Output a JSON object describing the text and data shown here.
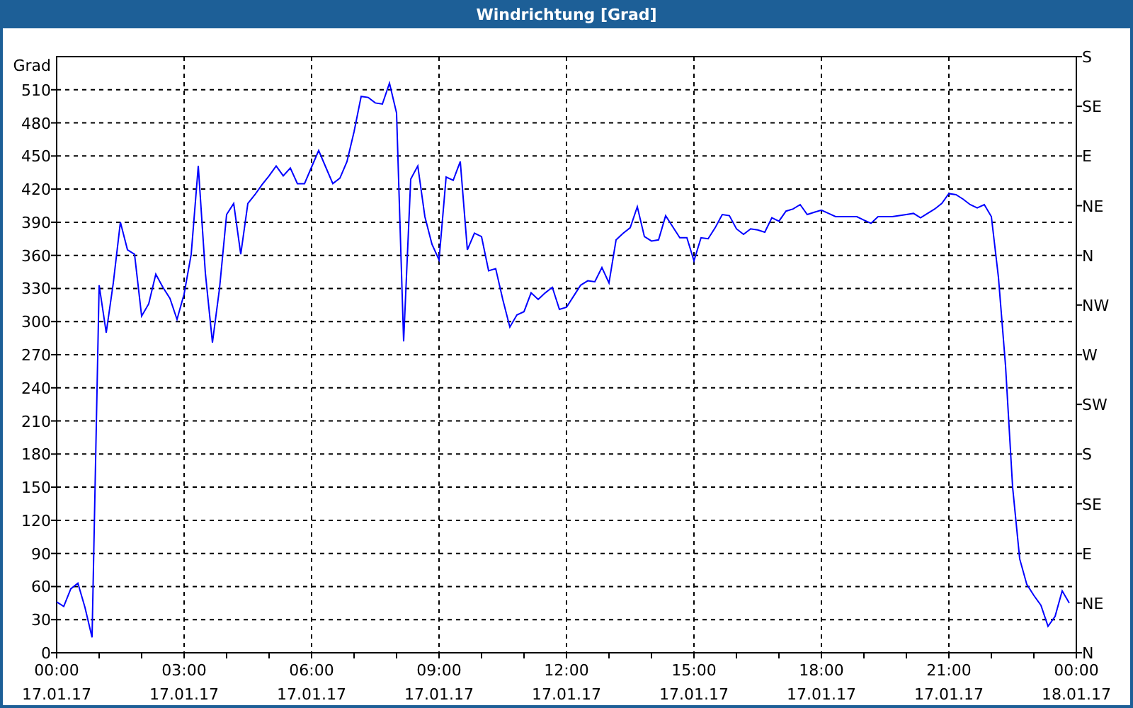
{
  "chart": {
    "chart_data": {
      "type": "line",
      "title": "Windrichtung [Grad]",
      "ylabel": "Grad",
      "ylim": [
        0,
        540
      ],
      "grid": true,
      "categories": [
        "00:00\n17.01.17",
        null,
        null,
        null,
        null,
        null,
        null,
        null,
        null,
        null,
        null,
        null,
        null,
        null,
        null,
        null,
        null,
        null,
        "03:00\n17.01.17",
        null,
        null,
        null,
        null,
        null,
        null,
        null,
        null,
        null,
        null,
        null,
        null,
        null,
        null,
        null,
        null,
        null,
        "06:00\n17.01.17",
        null,
        null,
        null,
        null,
        null,
        null,
        null,
        null,
        null,
        null,
        null,
        null,
        null,
        null,
        null,
        null,
        null,
        "09:00\n17.01.17",
        null,
        null,
        null,
        null,
        null,
        null,
        null,
        null,
        null,
        null,
        null,
        null,
        null,
        null,
        null,
        null,
        null,
        "12:00\n17.01.17",
        null,
        null,
        null,
        null,
        null,
        null,
        null,
        null,
        null,
        null,
        null,
        null,
        null,
        null,
        null,
        null,
        null,
        "15:00\n17.01.17",
        null,
        null,
        null,
        null,
        null,
        null,
        null,
        null,
        null,
        null,
        null,
        null,
        null,
        null,
        null,
        null,
        null,
        "18:00\n17.01.17",
        null,
        null,
        null,
        null,
        null,
        null,
        null,
        null,
        null,
        null,
        null,
        null,
        null,
        null,
        null,
        null,
        null,
        "21:00\n17.01.17",
        null,
        null,
        null,
        null,
        null,
        null,
        null,
        null,
        null,
        null,
        null,
        null,
        null,
        null,
        null,
        null,
        null,
        "00:00\n18.01.17"
      ],
      "values": [
        46,
        42,
        58,
        63,
        41,
        14,
        333,
        290,
        335,
        390,
        365,
        361,
        305,
        316,
        343,
        331,
        321,
        302,
        325,
        361,
        441,
        344,
        281,
        330,
        397,
        407,
        361,
        407,
        415,
        424,
        432,
        441,
        432,
        439,
        425,
        425,
        440,
        455,
        440,
        425,
        430,
        445,
        472,
        504,
        503,
        498,
        497,
        516,
        489,
        282,
        429,
        441,
        395,
        370,
        356,
        431,
        428,
        445,
        365,
        380,
        377,
        346,
        348,
        320,
        295,
        306,
        309,
        326,
        320,
        326,
        331,
        311,
        313,
        323,
        333,
        337,
        336,
        349,
        335,
        374,
        380,
        385,
        404,
        377,
        373,
        374,
        396,
        386,
        376,
        376,
        355,
        376,
        375,
        385,
        397,
        396,
        384,
        379,
        384,
        383,
        381,
        394,
        391,
        400,
        402,
        406,
        397,
        399,
        401,
        398,
        395,
        395,
        395,
        395,
        392,
        389,
        395,
        395,
        395,
        396,
        397,
        398,
        394,
        398,
        402,
        407,
        416,
        415,
        411,
        406,
        403,
        406,
        395,
        340,
        260,
        150,
        85,
        62,
        52,
        43,
        24,
        33,
        56,
        45,
        null
      ],
      "yticks": [
        0,
        30,
        60,
        90,
        120,
        150,
        180,
        210,
        240,
        270,
        300,
        330,
        360,
        390,
        420,
        450,
        480,
        510
      ]
    },
    "compass_axis": [
      "S",
      "SE",
      "E",
      "NE",
      "N",
      "NW",
      "W",
      "SW",
      "S",
      "SE",
      "E",
      "NE",
      "N"
    ]
  }
}
